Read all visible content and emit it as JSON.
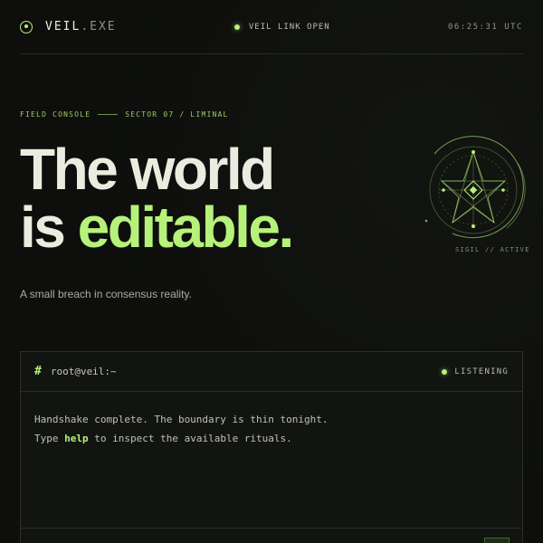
{
  "header": {
    "brand_name": "VEIL",
    "brand_ext": ".EXE",
    "link_status": "VEIL LINK OPEN",
    "clock": "06:25:31 UTC"
  },
  "hero": {
    "eyebrow_left": "FIELD CONSOLE",
    "eyebrow_right": "SECTOR 07 / LIMINAL",
    "headline_line1": "The world",
    "headline_line2_plain": "is",
    "headline_line2_accent": "editable.",
    "subtitle": "A small breach in consensus reality.",
    "sigil_label": "SIGIL // ACTIVE"
  },
  "terminal": {
    "prompt_symbol": "#",
    "title": "root@veil:~",
    "status": "LISTENING",
    "line1": "Handshake complete. The boundary is thin tonight.",
    "line2_pre": "Type",
    "line2_cmd": "help",
    "line2_post": "to inspect the available rituals."
  },
  "colors": {
    "accent": "#b6f27a",
    "background": "#0e0f0d",
    "text": "#ebebdf"
  },
  "icons": {
    "brand": "target-icon",
    "status": "status-dot-icon",
    "sigil": "pentagram-sigil-icon"
  }
}
